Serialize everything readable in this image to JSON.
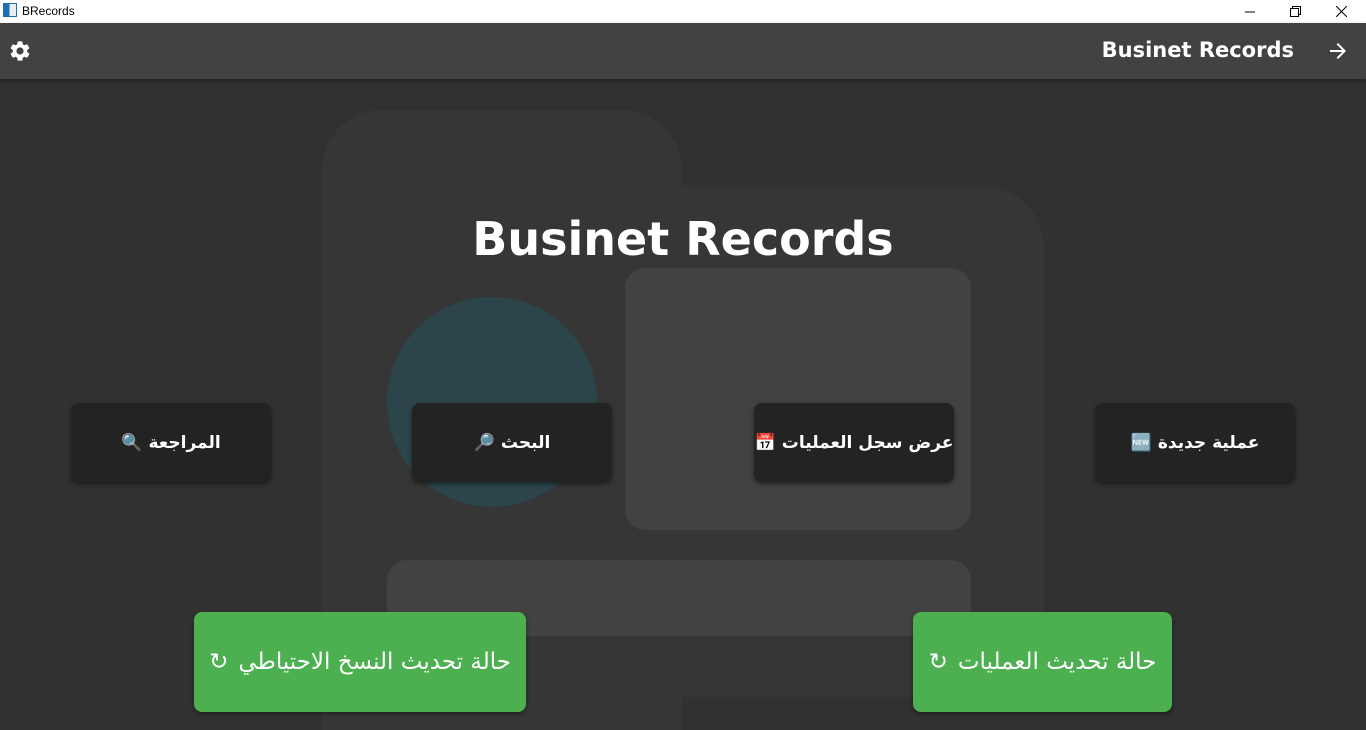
{
  "window": {
    "title": "BRecords",
    "controls": [
      "minimize",
      "restore",
      "close"
    ]
  },
  "appbar": {
    "title": "Businet Records",
    "settings_icon": "gear-icon",
    "back_icon": "arrow-right-icon"
  },
  "hero": {
    "title": "Businet Records"
  },
  "actions": [
    {
      "label": "المراجعة",
      "icon": "🔍"
    },
    {
      "label": "البحث",
      "icon": "🔎"
    },
    {
      "label": "عرض سجل العمليات",
      "icon": "📅"
    },
    {
      "label": "عملية جديدة",
      "icon": "🆕"
    }
  ],
  "status_buttons": [
    {
      "label": "حالة تحديث النسخ الاحتياطي",
      "icon": "↻"
    },
    {
      "label": "حالة تحديث العمليات",
      "icon": "↻"
    }
  ],
  "colors": {
    "background": "#313131",
    "appbar": "#424242",
    "button": "#232323",
    "accent_green": "#4caf50"
  }
}
